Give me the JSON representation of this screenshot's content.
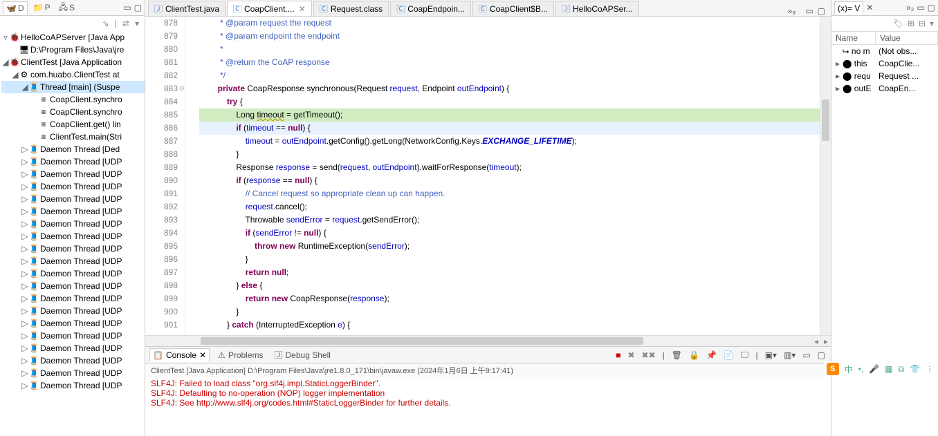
{
  "left": {
    "tabs": [
      {
        "label": "D",
        "active": true
      },
      {
        "label": "P"
      },
      {
        "label": "S"
      }
    ],
    "tree": [
      {
        "indent": 0,
        "twisty": "▿",
        "icon": "debug",
        "label": "HelloCoAPServer [Java App"
      },
      {
        "indent": 1,
        "twisty": "",
        "icon": "folder",
        "label": "D:\\Program Files\\Java\\jre"
      },
      {
        "indent": 0,
        "twisty": "◢",
        "icon": "debug",
        "label": "ClientTest [Java Application"
      },
      {
        "indent": 1,
        "twisty": "◢",
        "icon": "process",
        "label": "com.huabo.ClientTest at"
      },
      {
        "indent": 2,
        "twisty": "◢",
        "icon": "thread",
        "label": "Thread [main] (Suspe",
        "sel": true
      },
      {
        "indent": 3,
        "twisty": "",
        "icon": "stack",
        "label": "CoapClient.synchro"
      },
      {
        "indent": 3,
        "twisty": "",
        "icon": "stack",
        "label": "CoapClient.synchro"
      },
      {
        "indent": 3,
        "twisty": "",
        "icon": "stack",
        "label": "CoapClient.get() lin"
      },
      {
        "indent": 3,
        "twisty": "",
        "icon": "stack",
        "label": "ClientTest.main(Stri"
      },
      {
        "indent": 2,
        "twisty": "▷",
        "icon": "daemon",
        "label": "Daemon Thread [Ded"
      },
      {
        "indent": 2,
        "twisty": "▷",
        "icon": "daemon",
        "label": "Daemon Thread [UDP"
      },
      {
        "indent": 2,
        "twisty": "▷",
        "icon": "daemon",
        "label": "Daemon Thread [UDP"
      },
      {
        "indent": 2,
        "twisty": "▷",
        "icon": "daemon",
        "label": "Daemon Thread [UDP"
      },
      {
        "indent": 2,
        "twisty": "▷",
        "icon": "daemon",
        "label": "Daemon Thread [UDP"
      },
      {
        "indent": 2,
        "twisty": "▷",
        "icon": "daemon",
        "label": "Daemon Thread [UDP"
      },
      {
        "indent": 2,
        "twisty": "▷",
        "icon": "daemon",
        "label": "Daemon Thread [UDP"
      },
      {
        "indent": 2,
        "twisty": "▷",
        "icon": "daemon",
        "label": "Daemon Thread [UDP"
      },
      {
        "indent": 2,
        "twisty": "▷",
        "icon": "daemon",
        "label": "Daemon Thread [UDP"
      },
      {
        "indent": 2,
        "twisty": "▷",
        "icon": "daemon",
        "label": "Daemon Thread [UDP"
      },
      {
        "indent": 2,
        "twisty": "▷",
        "icon": "daemon",
        "label": "Daemon Thread [UDP"
      },
      {
        "indent": 2,
        "twisty": "▷",
        "icon": "daemon",
        "label": "Daemon Thread [UDP"
      },
      {
        "indent": 2,
        "twisty": "▷",
        "icon": "daemon",
        "label": "Daemon Thread [UDP"
      },
      {
        "indent": 2,
        "twisty": "▷",
        "icon": "daemon",
        "label": "Daemon Thread [UDP"
      },
      {
        "indent": 2,
        "twisty": "▷",
        "icon": "daemon",
        "label": "Daemon Thread [UDP"
      },
      {
        "indent": 2,
        "twisty": "▷",
        "icon": "daemon",
        "label": "Daemon Thread [UDP"
      },
      {
        "indent": 2,
        "twisty": "▷",
        "icon": "daemon",
        "label": "Daemon Thread [UDP"
      },
      {
        "indent": 2,
        "twisty": "▷",
        "icon": "daemon",
        "label": "Daemon Thread [UDP"
      },
      {
        "indent": 2,
        "twisty": "▷",
        "icon": "daemon",
        "label": "Daemon Thread [UDP"
      },
      {
        "indent": 2,
        "twisty": "▷",
        "icon": "daemon",
        "label": "Daemon Thread [UDP"
      }
    ]
  },
  "editor_tabs": [
    {
      "label": "ClientTest.java",
      "active": false
    },
    {
      "label": "CoapClient....",
      "active": true
    },
    {
      "label": "Request.class",
      "active": false
    },
    {
      "label": "CoapEndpoin...",
      "active": false
    },
    {
      "label": "CoapClient$B...",
      "active": false
    },
    {
      "label": "HelloCoAPSer...",
      "active": false
    }
  ],
  "editor_more": "»₈",
  "code_lines": [
    {
      "n": 878,
      "html": "         <span class='cm'>* @param request the request</span>"
    },
    {
      "n": 879,
      "html": "         <span class='cm'>* @param endpoint the endpoint</span>"
    },
    {
      "n": 880,
      "html": "         <span class='cm'>*</span>"
    },
    {
      "n": 881,
      "html": "         <span class='cm'>* @return the CoAP response</span>"
    },
    {
      "n": 882,
      "html": "         <span class='cm'>*/</span>"
    },
    {
      "n": 883,
      "fold": true,
      "html": "        <span class='kw'>private</span> CoapResponse synchronous(Request <span class='fld'>request</span>, Endpoint <span class='fld'>outEndpoint</span>) {"
    },
    {
      "n": 884,
      "html": "            <span class='kw'>try</span> {"
    },
    {
      "n": 885,
      "arrow": true,
      "hl": "green",
      "html": "                Long <span class='warn'>timeout</span> = getTimeout();"
    },
    {
      "n": 886,
      "hl": "blue",
      "html": "                <span class='kw'>if</span> (<span class='fld'>timeout</span> == <span class='kw'>null</span>) {"
    },
    {
      "n": 887,
      "html": "                    <span class='fld'>timeout</span> = <span class='fld'>outEndpoint</span>.getConfig().getLong(NetworkConfig.Keys.<span class='st'>EXCHANGE_LIFETIME</span>);"
    },
    {
      "n": 888,
      "html": "                }"
    },
    {
      "n": 889,
      "html": "                Response <span class='fld'>response</span> = send(<span class='fld'>request</span>, <span class='fld'>outEndpoint</span>).waitForResponse(<span class='fld'>timeout</span>);"
    },
    {
      "n": 890,
      "html": "                <span class='kw'>if</span> (<span class='fld'>response</span> == <span class='kw'>null</span>) {"
    },
    {
      "n": 891,
      "html": "                    <span class='cm'>// Cancel request so appropriate clean up can happen.</span>"
    },
    {
      "n": 892,
      "html": "                    <span class='fld'>request</span>.cancel();"
    },
    {
      "n": 893,
      "html": "                    Throwable <span class='fld'>sendError</span> = <span class='fld'>request</span>.getSendError();"
    },
    {
      "n": 894,
      "html": "                    <span class='kw'>if</span> (<span class='fld'>sendError</span> != <span class='kw'>null</span>) {"
    },
    {
      "n": 895,
      "html": "                        <span class='kw'>throw new</span> RuntimeException(<span class='fld'>sendError</span>);"
    },
    {
      "n": 896,
      "html": "                    }"
    },
    {
      "n": 897,
      "html": "                    <span class='kw'>return null</span>;"
    },
    {
      "n": 898,
      "html": "                } <span class='kw'>else</span> {"
    },
    {
      "n": 899,
      "html": "                    <span class='kw'>return new</span> CoapResponse(<span class='fld'>response</span>);"
    },
    {
      "n": 900,
      "html": "                }"
    },
    {
      "n": 901,
      "html": "            } <span class='kw'>catch</span> (InterruptedException <span class='fld'>e</span>) {"
    }
  ],
  "console": {
    "tabs": [
      {
        "label": "Console",
        "active": true
      },
      {
        "label": "Problems",
        "active": false
      },
      {
        "label": "Debug Shell",
        "active": false
      }
    ],
    "label": "ClientTest [Java Application] D:\\Program Files\\Java\\jre1.8.0_171\\bin\\javaw.exe (2024年1月6日 上午9:17:41)",
    "lines": [
      "SLF4J: Failed to load class \"org.slf4j.impl.StaticLoggerBinder\".",
      "SLF4J: Defaulting to no-operation (NOP) logger implementation",
      "SLF4J: See http://www.slf4j.org/codes.html#StaticLoggerBinder for further details."
    ]
  },
  "vars": {
    "tab": "(x)= V",
    "more": "»₂",
    "cols": {
      "name": "Name",
      "value": "Value"
    },
    "rows": [
      {
        "icon": "input",
        "name": "no m",
        "value": "(Not obs..."
      },
      {
        "icon": "this",
        "name": "this",
        "value": "CoapClie..."
      },
      {
        "icon": "arg",
        "name": "requ",
        "value": "Request ..."
      },
      {
        "icon": "arg",
        "name": "outE",
        "value": "CoapEn..."
      }
    ]
  },
  "ime": [
    "中",
    "•,",
    "🎤",
    "▦",
    "⧉",
    "👕",
    "⋮"
  ]
}
